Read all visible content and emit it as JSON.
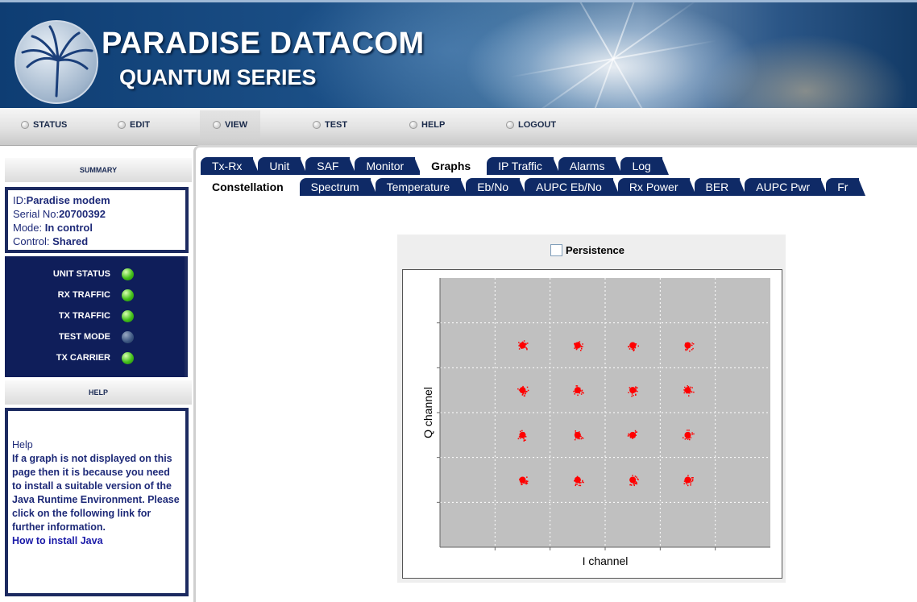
{
  "header": {
    "brand_title": "PARADISE DATACOM",
    "brand_subtitle": "QUANTUM SERIES"
  },
  "topnav": [
    "STATUS",
    "EDIT",
    "VIEW",
    "TEST",
    "HELP",
    "LOGOUT"
  ],
  "sidebar": {
    "summary_header": "SUMMARY",
    "summary": {
      "id_label": "ID:",
      "id_value": "Paradise modem",
      "serial_label": "Serial No:",
      "serial_value": "20700392",
      "mode_label": "Mode: ",
      "mode_value": "In control",
      "control_label": "Control: ",
      "control_value": "Shared"
    },
    "status": [
      {
        "label": "UNIT STATUS",
        "state": "green"
      },
      {
        "label": "RX TRAFFIC",
        "state": "green"
      },
      {
        "label": "TX TRAFFIC",
        "state": "green"
      },
      {
        "label": "TEST MODE",
        "state": "off"
      },
      {
        "label": "TX CARRIER",
        "state": "green"
      }
    ],
    "help_header": "HELP",
    "help": {
      "title": "Help",
      "body": "If a graph is not displayed on this page then it is because you need to install a suitable version of the Java Runtime Environment. Please click on the following link for further information.",
      "link": "How to install Java"
    }
  },
  "tabs_main": [
    "Tx-Rx",
    "Unit",
    "SAF",
    "Monitor",
    "Graphs",
    "IP Traffic",
    "Alarms",
    "Log"
  ],
  "tabs_main_active": "Graphs",
  "tabs_sub": [
    "Constellation",
    "Spectrum",
    "Temperature",
    "Eb/No",
    "AUPC Eb/No",
    "Rx Power",
    "BER",
    "AUPC Pwr",
    "Fr"
  ],
  "tabs_sub_active": "Constellation",
  "applet": {
    "persistence_label": "Persistence",
    "persistence_checked": false
  },
  "chart_data": {
    "type": "scatter",
    "title": "",
    "xlabel": "I channel",
    "ylabel": "Q channel",
    "grid": true,
    "point_color": "#ff0000",
    "plot_background": "#c0c0c0",
    "x_levels": [
      -3,
      -1,
      1,
      3
    ],
    "y_levels": [
      3,
      1,
      -1,
      -3
    ],
    "xlim": [
      -6,
      6
    ],
    "ylim": [
      -6,
      6
    ],
    "points": [
      {
        "x": -3,
        "y": 3
      },
      {
        "x": -1,
        "y": 3
      },
      {
        "x": 1,
        "y": 3
      },
      {
        "x": 3,
        "y": 3
      },
      {
        "x": -3,
        "y": 1
      },
      {
        "x": -1,
        "y": 1
      },
      {
        "x": 1,
        "y": 1
      },
      {
        "x": 3,
        "y": 1
      },
      {
        "x": -3,
        "y": -1
      },
      {
        "x": -1,
        "y": -1
      },
      {
        "x": 1,
        "y": -1
      },
      {
        "x": 3,
        "y": -1
      },
      {
        "x": -3,
        "y": -3
      },
      {
        "x": -1,
        "y": -3
      },
      {
        "x": 1,
        "y": -3
      },
      {
        "x": 3,
        "y": -3
      }
    ]
  }
}
